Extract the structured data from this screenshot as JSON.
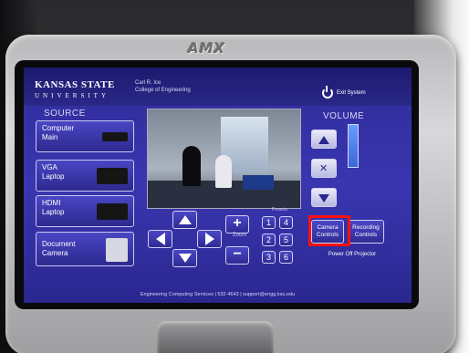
{
  "device": {
    "brand": "AMX"
  },
  "header": {
    "university_line1": "KANSAS STATE",
    "university_line2": "UNIVERSITY",
    "dept_line1": "Carl R. Ice",
    "dept_line2": "College of Engineering",
    "exit_label": "Exit System"
  },
  "source": {
    "title": "SOURCE",
    "items": [
      {
        "line1": "Computer",
        "line2": "Main"
      },
      {
        "line1": "VGA",
        "line2": "Laptop"
      },
      {
        "line1": "HDMI",
        "line2": "Laptop"
      },
      {
        "line1": "Document",
        "line2": "Camera"
      }
    ]
  },
  "camera": {
    "zoom_label": "Zoom",
    "presets_label": "Presets",
    "zoom_in": "+",
    "zoom_out": "−",
    "presets": [
      "1",
      "4",
      "2",
      "5",
      "3",
      "6"
    ]
  },
  "volume": {
    "title": "VOLUME"
  },
  "modes": {
    "camera_controls": "Camera Controls",
    "recording_controls": "Recording Controls",
    "power_off": "Power Off Projector"
  },
  "footer": {
    "text": "Engineering Computing Services | 532-4643 | support@engg.ksu.edu"
  },
  "colors": {
    "panel": "#3a36b0",
    "highlight": "#ff1010"
  }
}
